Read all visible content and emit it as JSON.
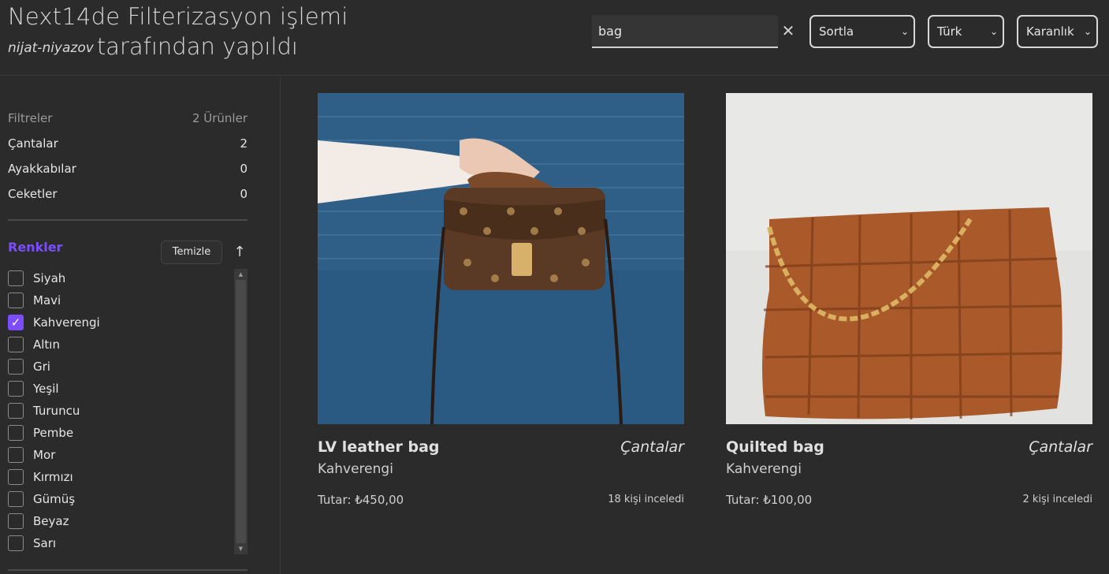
{
  "header": {
    "title_line1": "Next14de Filterizasyon işlemi",
    "author": "nijat-niyazov",
    "title_line2_rest": "tarafından yapıldı"
  },
  "search": {
    "value": "bag",
    "clear_icon": "close-icon"
  },
  "selects": {
    "sort": "Sortla",
    "language": "Türk",
    "theme": "Karanlık"
  },
  "sidebar": {
    "filters_label": "Filtreler",
    "products_count": "2 Ürünler",
    "categories": [
      {
        "label": "Çantalar",
        "count": "2"
      },
      {
        "label": "Ayakkabılar",
        "count": "0"
      },
      {
        "label": "Ceketler",
        "count": "0"
      }
    ],
    "colors_title": "Renkler",
    "clear_label": "Temizle",
    "colors": [
      {
        "label": "Siyah",
        "checked": false
      },
      {
        "label": "Mavi",
        "checked": false
      },
      {
        "label": "Kahverengi",
        "checked": true
      },
      {
        "label": "Altın",
        "checked": false
      },
      {
        "label": "Gri",
        "checked": false
      },
      {
        "label": "Yeşil",
        "checked": false
      },
      {
        "label": "Turuncu",
        "checked": false
      },
      {
        "label": "Pembe",
        "checked": false
      },
      {
        "label": "Mor",
        "checked": false
      },
      {
        "label": "Kırmızı",
        "checked": false
      },
      {
        "label": "Gümüş",
        "checked": false
      },
      {
        "label": "Beyaz",
        "checked": false
      },
      {
        "label": "Sarı",
        "checked": false
      }
    ]
  },
  "products": [
    {
      "name": "LV leather bag",
      "category": "Çantalar",
      "color": "Kahverengi",
      "price": "Tutar: ₺450,00",
      "views": "18 kişi inceledi"
    },
    {
      "name": "Quilted bag",
      "category": "Çantalar",
      "color": "Kahverengi",
      "price": "Tutar: ₺100,00",
      "views": "2 kişi inceledi"
    }
  ],
  "colors": {
    "background": "#2b2b2b",
    "accent": "#7c4dff"
  }
}
